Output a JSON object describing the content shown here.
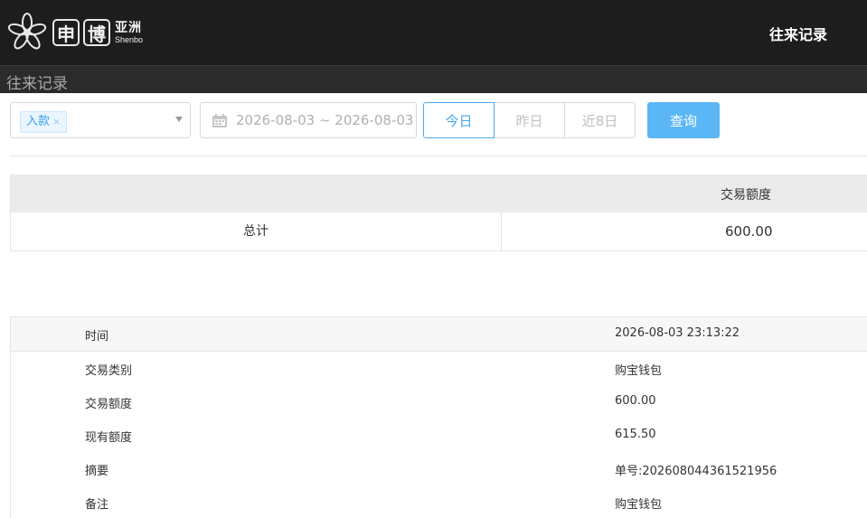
{
  "header": {
    "logo_box1": "申",
    "logo_box2": "博",
    "logo_cn": "亚洲",
    "logo_en": "Shenbo",
    "title": "往来记录"
  },
  "subheader": {
    "title": "往来记录"
  },
  "filters": {
    "type_tag": "入款",
    "tag_close": "×",
    "date_range": "2026-08-03 ~ 2026-08-03",
    "quick_ranges": [
      "今日",
      "昨日",
      "近8日"
    ],
    "active_range": "今日",
    "query_label": "查询"
  },
  "summary": {
    "header_label": "交易额度",
    "total_label": "总计",
    "total_value": "600.00"
  },
  "record": {
    "rows": [
      {
        "label": "时间",
        "value": "2026-08-03 23:13:22"
      },
      {
        "label": "交易类别",
        "value": "购宝钱包"
      },
      {
        "label": "交易额度",
        "value": "600.00"
      },
      {
        "label": "现有额度",
        "value": "615.50"
      },
      {
        "label": "摘要",
        "value": "单号:202608044361521956"
      },
      {
        "label": "备注",
        "value": "购宝钱包"
      }
    ]
  },
  "colors": {
    "topbar": "#1d1d1d",
    "accent": "#4aa8ef",
    "query_button": "#5bb6f5"
  },
  "icons": [
    "flower-logo-icon",
    "close-icon",
    "chevron-down-icon",
    "calendar-icon"
  ]
}
